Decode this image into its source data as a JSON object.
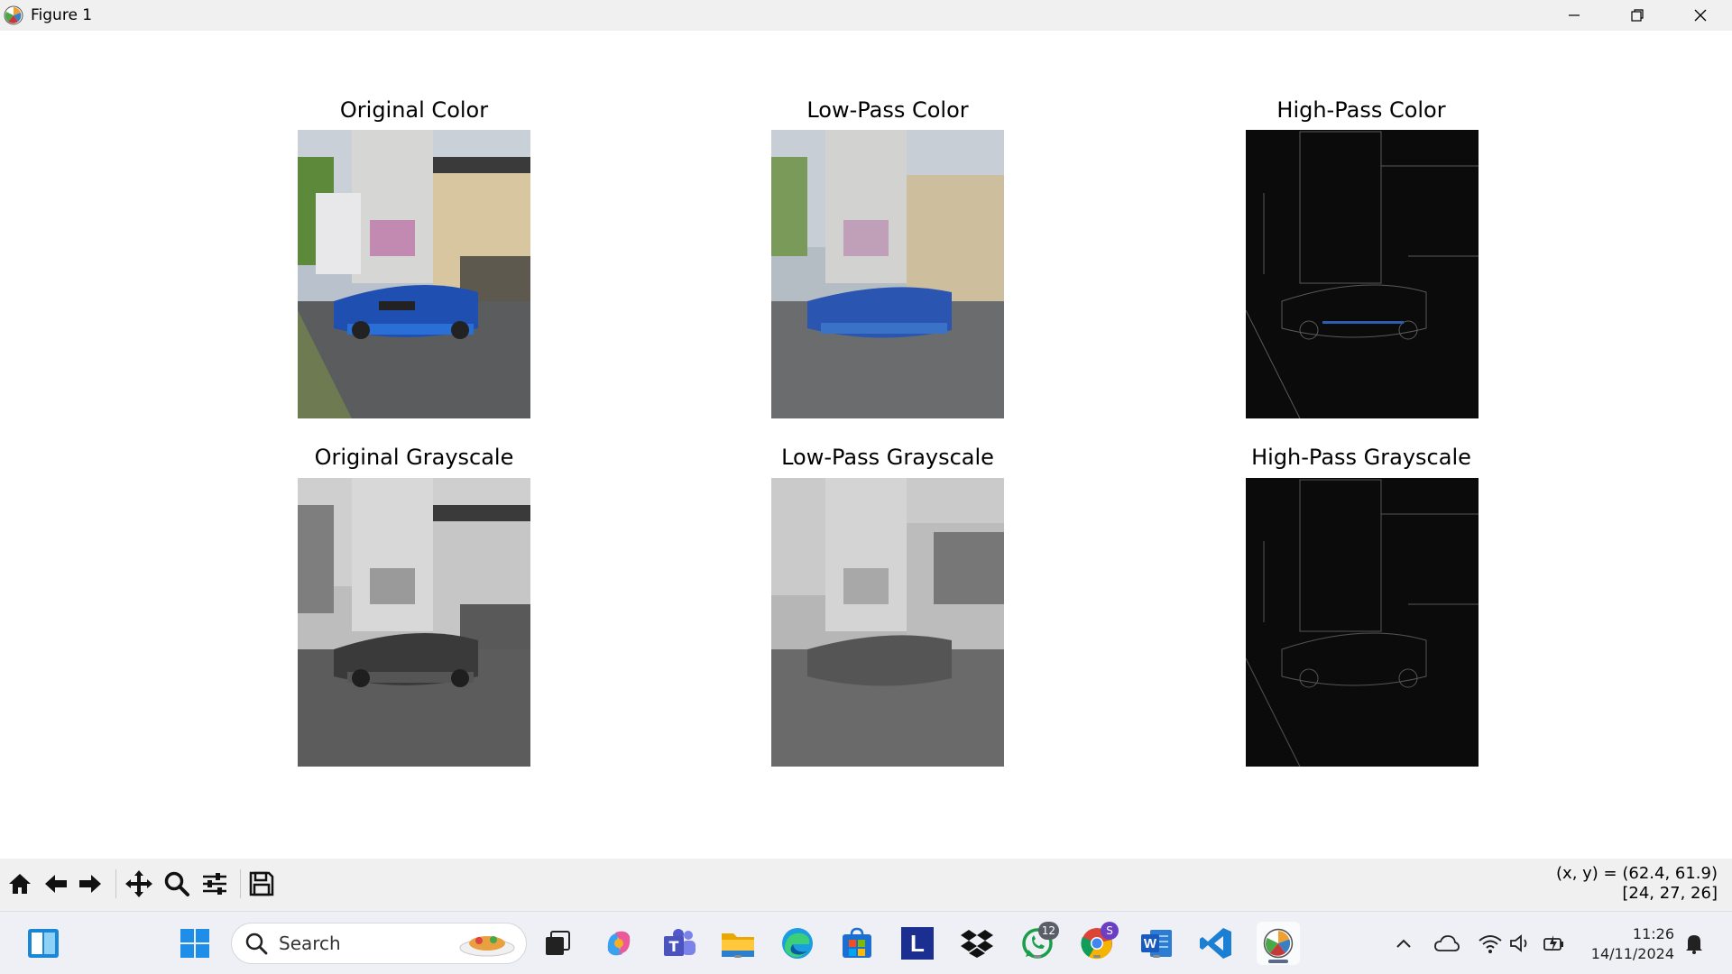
{
  "window": {
    "title": "Figure 1",
    "app_icon": "matplotlib-icon",
    "controls": [
      "minimize-icon",
      "restore-icon",
      "close-icon"
    ]
  },
  "figure": {
    "panels": [
      {
        "title": "Original Color",
        "content": "car-photo-color"
      },
      {
        "title": "Low-Pass Color",
        "content": "car-photo-color-blurred"
      },
      {
        "title": "High-Pass Color",
        "content": "car-photo-color-edges"
      },
      {
        "title": "Original Grayscale",
        "content": "car-photo-gray"
      },
      {
        "title": "Low-Pass Grayscale",
        "content": "car-photo-gray-blurred"
      },
      {
        "title": "High-Pass Grayscale",
        "content": "car-photo-gray-edges"
      }
    ]
  },
  "toolbar": {
    "buttons": [
      "home-icon",
      "back-icon",
      "forward-icon",
      "pan-icon",
      "zoom-icon",
      "configure-icon",
      "save-icon"
    ],
    "coords_line1": "(x, y) = (62.4, 61.9)",
    "coords_line2": "[24, 27, 26]"
  },
  "taskbar": {
    "search_placeholder": "Search",
    "whatsapp_badge": "12",
    "chrome_badge": "S",
    "launcher_letter": "L",
    "word_letter": "W",
    "time": "11:26",
    "date": "14/11/2024"
  },
  "colors": {
    "taskbar_bg": "#eef0f5",
    "toolbar_bg": "#f0f0f0",
    "car_blue": "#1f4fb0"
  }
}
